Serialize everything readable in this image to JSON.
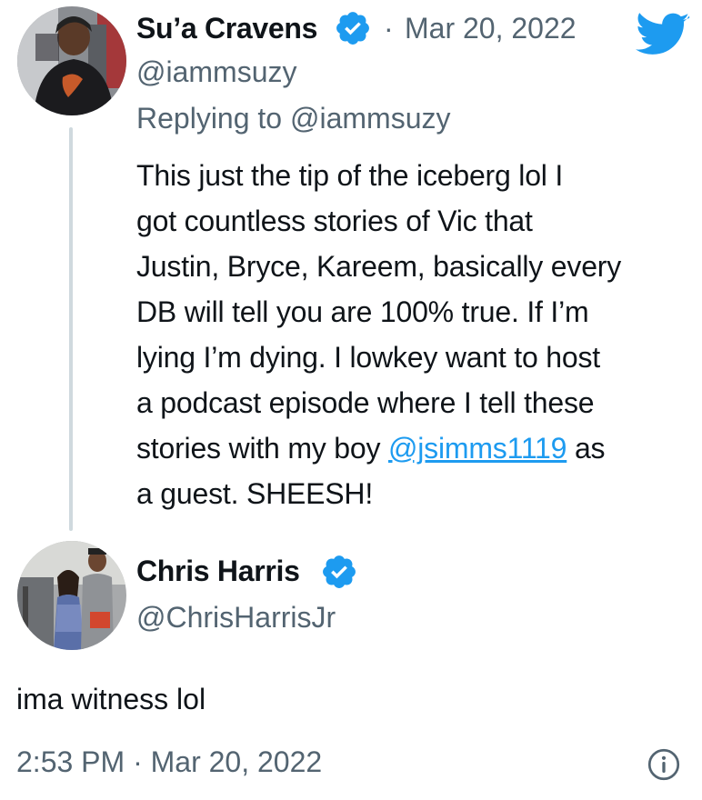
{
  "tweet1": {
    "display_name": "Su’a Cravens",
    "dot": "·",
    "date": "Mar 20, 2022",
    "handle": "@iammsuzy",
    "replying_prefix": "Replying to",
    "replying_handle": "@iammsuzy",
    "lines": [
      "This just the tip of the iceberg lol I",
      "got countless stories of Vic that",
      "Justin, Bryce, Kareem, basically every",
      "DB will tell you are 100% true. If I’m",
      "lying I’m dying. I lowkey want to host",
      "a podcast episode where I tell these"
    ],
    "line7_before": "stories with my boy ",
    "line7_mention": "@jsimms1119",
    "line7_after": " as",
    "line8": "a guest. SHEESH!"
  },
  "tweet2": {
    "display_name": "Chris Harris",
    "handle": "@ChrisHarrisJr",
    "text": "ima witness lol",
    "timestamp": "2:53 PM · Mar 20, 2022"
  },
  "icons": {
    "verified": "verified-badge-icon",
    "logo": "twitter-bird-icon",
    "info": "info-icon"
  },
  "colors": {
    "accent": "#1d9bf0",
    "muted": "#536471",
    "text": "#0f1419"
  }
}
